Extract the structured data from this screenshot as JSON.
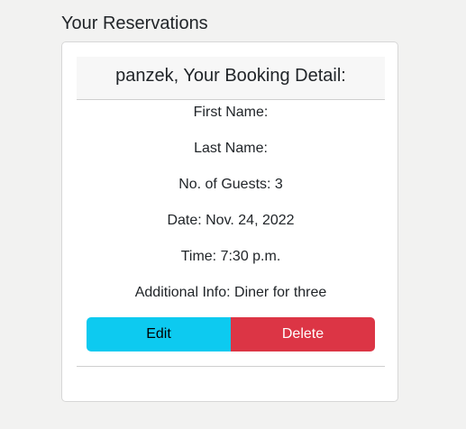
{
  "page": {
    "title": "Your Reservations"
  },
  "reservation": {
    "header": "panzek, Your Booking Detail:",
    "first_name": "First Name:",
    "last_name": "Last Name:",
    "guests": "No. of Guests: 3",
    "date": "Date: Nov. 24, 2022",
    "time": "Time: 7:30 p.m.",
    "additional_info": "Additional Info: Diner for three"
  },
  "actions": {
    "edit_label": "Edit",
    "delete_label": "Delete"
  },
  "colors": {
    "page_background": "#f2f2f1",
    "edit_button": "#0dcaf0",
    "delete_button": "#dc3545",
    "card_header_background": "#f7f7f7"
  }
}
